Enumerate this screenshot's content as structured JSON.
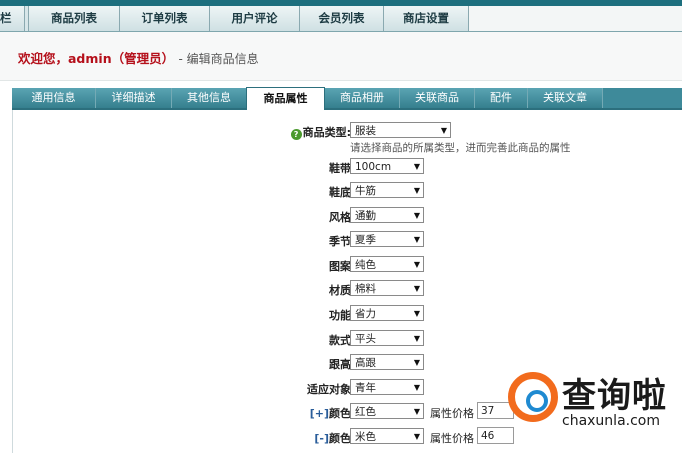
{
  "top_nav": {
    "partial_first": "栏",
    "items": [
      "商品列表",
      "订单列表",
      "用户评论",
      "会员列表",
      "商店设置"
    ]
  },
  "header": {
    "welcome": "欢迎您，admin（管理员）",
    "subtitle": "- 编辑商品信息"
  },
  "tabs": [
    "通用信息",
    "详细描述",
    "其他信息",
    "商品属性",
    "商品相册",
    "关联商品",
    "配件",
    "关联文章"
  ],
  "active_tab": "商品属性",
  "form": {
    "product_type": {
      "label": "商品类型:",
      "value": "服装",
      "hint": "请选择商品的所属类型，进而完善此商品的属性"
    },
    "attributes": [
      {
        "label": "鞋带",
        "value": "100cm"
      },
      {
        "label": "鞋底",
        "value": "牛筋"
      },
      {
        "label": "风格",
        "value": "通勤"
      },
      {
        "label": "季节",
        "value": "夏季"
      },
      {
        "label": "图案",
        "value": "纯色"
      },
      {
        "label": "材质",
        "value": "棉料"
      },
      {
        "label": "功能",
        "value": "省力"
      },
      {
        "label": "款式",
        "value": "平头"
      },
      {
        "label": "跟高",
        "value": "高跟"
      },
      {
        "label": "适应对象",
        "value": "青年"
      }
    ],
    "color_rows": [
      {
        "toggle": "[+]",
        "label": "颜色",
        "value": "红色",
        "price_label": "属性价格",
        "price": "37"
      },
      {
        "toggle": "[-]",
        "label": "颜色",
        "value": "米色",
        "price_label": "属性价格",
        "price": "46"
      }
    ]
  },
  "watermark": {
    "title": "查询啦",
    "domain": "chaxunla.com"
  },
  "colors": {
    "nav_bg": "#d7e6e9",
    "tab_bg": "#3e8a9a",
    "welcome_red": "#b5101b",
    "top_strip": "#1d6f7e"
  }
}
